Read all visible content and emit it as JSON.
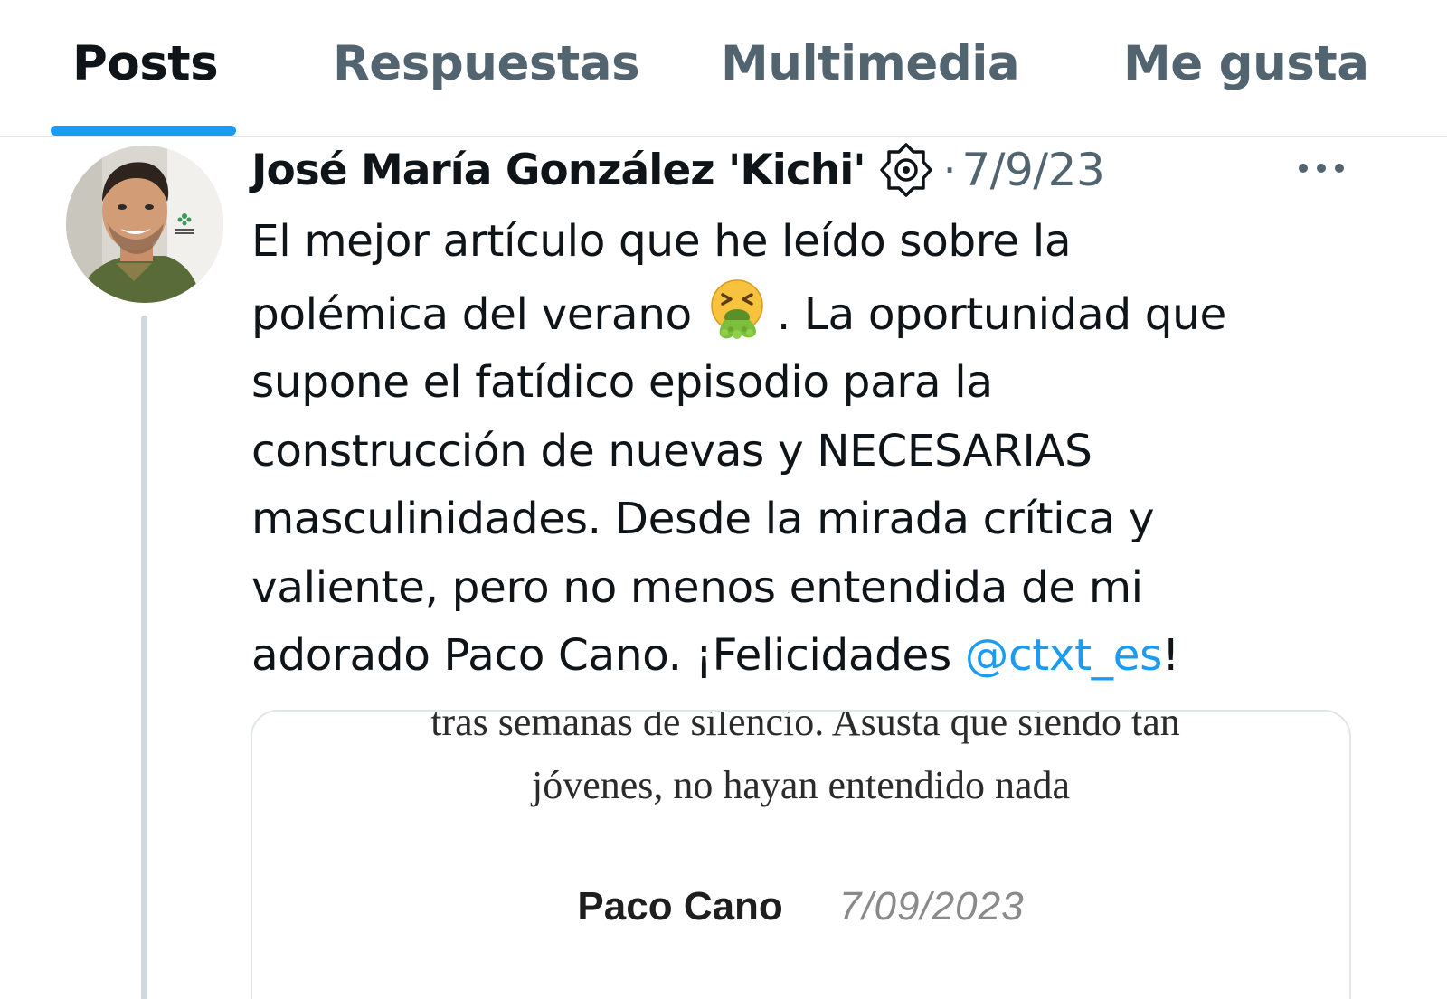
{
  "tabs": [
    {
      "label": "Posts",
      "active": true
    },
    {
      "label": "Respuestas",
      "active": false
    },
    {
      "label": "Multimedia",
      "active": false
    },
    {
      "label": "Me gusta",
      "active": false
    }
  ],
  "post": {
    "author_name": "José María González 'Kichi'",
    "separator": "·",
    "date": "7/9/23",
    "verified_icon": "verified-badge-icon",
    "more_icon": "more-options-icon",
    "avatar_icon": "user-avatar",
    "text": {
      "line1": "El mejor artículo que he leído sobre la",
      "line2_a": "polémica del verano",
      "line2_emoji": "face-vomiting-emoji",
      "line2_b": ". La oportunidad que",
      "line3": "supone el fatídico episodio para la",
      "line4": "construcción de nuevas y NECESARIAS",
      "line5": "masculinidades. Desde la mirada crítica y",
      "line6": "valiente, pero no menos entendida de mi",
      "line7_a": "adorado Paco Cano. ¡Felicidades ",
      "mention": "@ctxt_es",
      "line7_b": "!"
    },
    "media": {
      "line1": "tras semanas de silencio. Asusta que siendo tan",
      "line2": "jóvenes, no hayan entendido nada",
      "author": "Paco Cano",
      "date": "7/09/2023"
    }
  },
  "colors": {
    "accent": "#1d9bf0",
    "text_primary": "#0f1419",
    "text_secondary": "#536471",
    "border": "#e3e6e9",
    "thread_line": "#cfd9de"
  }
}
